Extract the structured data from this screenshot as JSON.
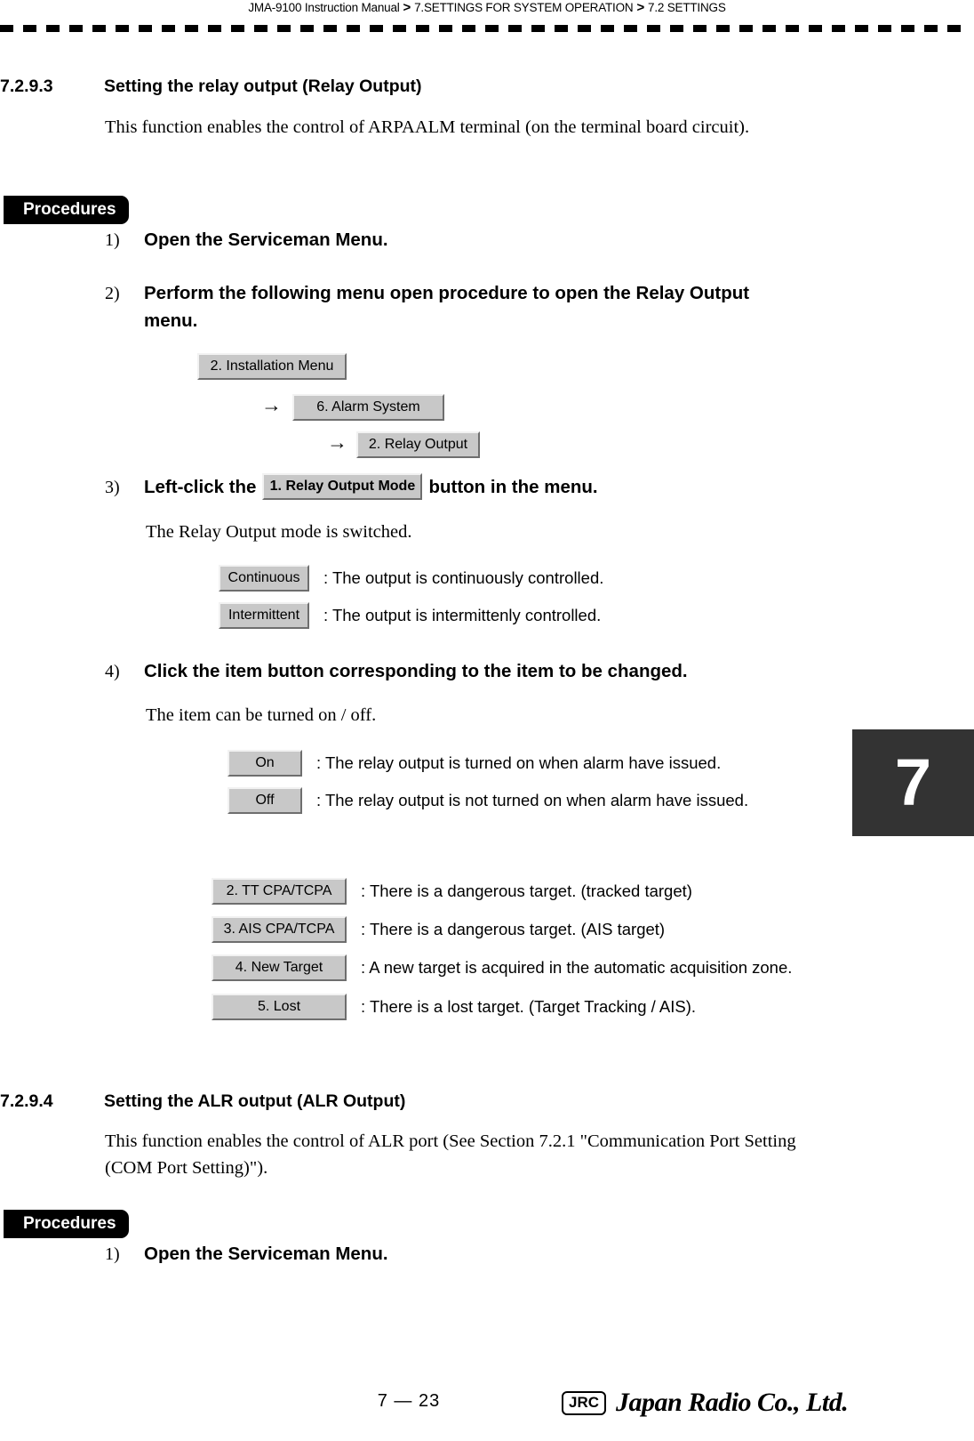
{
  "header": {
    "manual": "JMA-9100 Instruction Manual",
    "sep1": ">",
    "chapter": "7.SETTINGS FOR SYSTEM OPERATION",
    "sep2": ">",
    "section": "7.2  SETTINGS"
  },
  "chapter_tab": {
    "number": "7"
  },
  "section_7293": {
    "number": "7.2.9.3",
    "title": "Setting the relay output (Relay Output)",
    "intro": "This function enables the control of ARPAALM terminal (on the terminal board circuit).",
    "procedures_label": "Procedures",
    "steps": [
      {
        "num": "1)",
        "text": "Open the Serviceman Menu."
      },
      {
        "num": "2)",
        "text": "Perform the following menu open procedure to open the Relay Output menu."
      },
      {
        "num": "3)",
        "pre": "Left-click the",
        "button": "1. Relay Output Mode",
        "post": "button in the menu."
      },
      {
        "num": "4)",
        "text": "Click the item button corresponding to the item to be changed."
      }
    ],
    "menu_path": {
      "arrow": "→",
      "items": [
        {
          "label": "2. Installation Menu"
        },
        {
          "label": "6. Alarm System"
        },
        {
          "label": "2. Relay Output"
        }
      ]
    },
    "mode_note": "The Relay Output mode is switched.",
    "mode_options": [
      {
        "button": "Continuous",
        "desc": ": The output is continuously controlled."
      },
      {
        "button": "Intermittent",
        "desc": ": The output is intermittenly controlled."
      }
    ],
    "item_note": "The item can be turned on / off.",
    "onoff_options": [
      {
        "button": "On",
        "desc": ": The relay output is turned on when alarm have issued."
      },
      {
        "button": "Off",
        "desc": ": The relay output is not turned on when alarm have issued."
      }
    ],
    "target_options": [
      {
        "button": "2. TT CPA/TCPA",
        "desc": ": There is a dangerous target. (tracked target)"
      },
      {
        "button": "3. AIS CPA/TCPA",
        "desc": ": There is a dangerous target. (AIS target)"
      },
      {
        "button": "4. New Target",
        "desc": ": A new target is acquired in the automatic acquisition zone."
      },
      {
        "button": "5. Lost",
        "desc": ": There is a lost target. (Target Tracking / AIS)."
      }
    ]
  },
  "section_7294": {
    "number": "7.2.9.4",
    "title": "Setting the ALR output  (ALR Output)",
    "intro": "This function enables the control of ALR port (See Section 7.2.1 \"Communication Port Setting (COM Port Setting)\").",
    "procedures_label": "Procedures",
    "steps": [
      {
        "num": "1)",
        "text": "Open the Serviceman Menu."
      }
    ]
  },
  "footer": {
    "page_number": "7 — 23",
    "logo_mark": "JRC",
    "logo_name": "Japan Radio Co., Ltd."
  }
}
